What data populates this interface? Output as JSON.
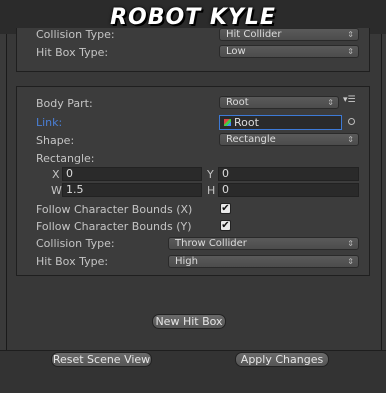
{
  "header": {
    "title": "ROBOT KYLE"
  },
  "top_box": {
    "collision_type_label": "Collision Type:",
    "collision_type_value": "Hit Collider",
    "hit_box_type_label": "Hit Box Type:",
    "hit_box_type_value": "Low"
  },
  "hitbox": {
    "body_part_label": "Body Part:",
    "body_part_value": "Root",
    "link_label": "Link:",
    "link_value": "Root",
    "shape_label": "Shape:",
    "shape_value": "Rectangle",
    "rectangle_label": "Rectangle:",
    "x_label": "X",
    "x_value": "0",
    "y_label": "Y",
    "y_value": "0",
    "w_label": "W",
    "w_value": "1.5",
    "h_label": "H",
    "h_value": "0",
    "follow_x_label": "Follow Character Bounds (X)",
    "follow_x_checked": true,
    "follow_y_label": "Follow Character Bounds (Y)",
    "follow_y_checked": true,
    "collision_type_label": "Collision Type:",
    "collision_type_value": "Throw Collider",
    "hit_box_type_label": "Hit Box Type:",
    "hit_box_type_value": "High"
  },
  "buttons": {
    "new_hit_box": "New Hit Box",
    "reset_scene_view": "Reset Scene View",
    "apply_changes": "Apply Changes"
  },
  "icons": {
    "dropdown": "updown-arrow-icon",
    "check": "✔",
    "menu": "gear-menu-icon",
    "object_picker": "object-picker-icon"
  }
}
